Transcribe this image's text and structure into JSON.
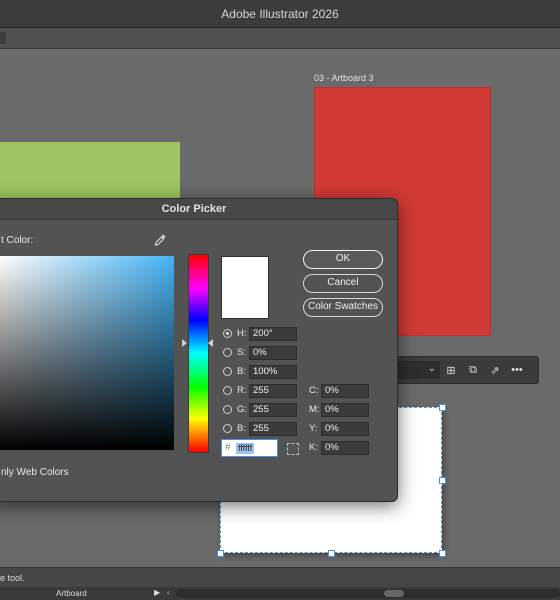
{
  "app": {
    "title": "Adobe Illustrator 2026"
  },
  "canvas": {
    "artboard_label": "03 - Artboard 3",
    "colors": {
      "red": "#d23a35",
      "green": "#9ec562",
      "white": "#ffffff",
      "canvas": "#6a6a6a"
    }
  },
  "dialog": {
    "title": "Color Picker",
    "select_label": "t Color:",
    "buttons": {
      "ok": "OK",
      "cancel": "Cancel",
      "swatches": "Color Swatches"
    },
    "hsb": [
      {
        "label": "H:",
        "value": "200°"
      },
      {
        "label": "S:",
        "value": "0%"
      },
      {
        "label": "B:",
        "value": "100%"
      }
    ],
    "rgb": [
      {
        "label": "R:",
        "value": "255"
      },
      {
        "label": "G:",
        "value": "255"
      },
      {
        "label": "B:",
        "value": "255"
      }
    ],
    "cmyk": [
      {
        "label": "C:",
        "value": "0%"
      },
      {
        "label": "M:",
        "value": "0%"
      },
      {
        "label": "Y:",
        "value": "0%"
      },
      {
        "label": "K:",
        "value": "0%"
      }
    ],
    "hex": {
      "hash": "#",
      "value": "ffffff"
    },
    "web_only": "nly Web Colors",
    "selected_color": "#ffffff",
    "hue_color": "#45b3f5"
  },
  "context_bar": {
    "icons": [
      "add-artboard-icon",
      "duplicate-icon",
      "export-icon",
      "more-icon"
    ]
  },
  "status": {
    "text": "e tool.",
    "artboard_nav": "Artboard"
  }
}
